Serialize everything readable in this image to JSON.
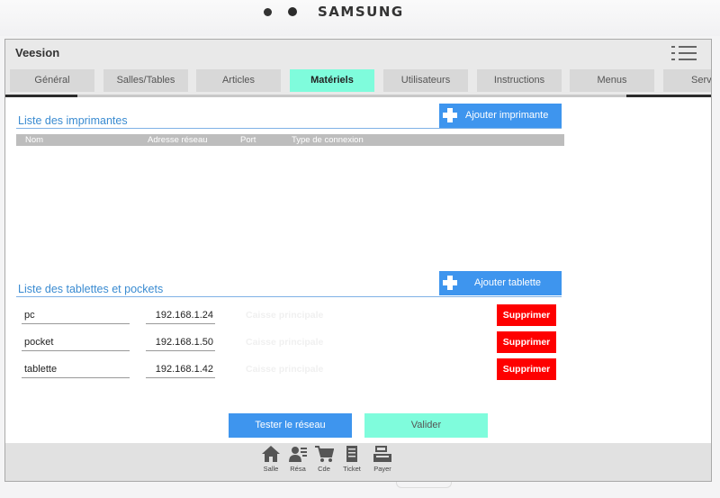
{
  "device": {
    "brand": "SAMSUNG"
  },
  "app": {
    "title": "Veesion"
  },
  "tabs": [
    {
      "label": "Général"
    },
    {
      "label": "Salles/Tables"
    },
    {
      "label": "Articles"
    },
    {
      "label": "Matériels"
    },
    {
      "label": "Utilisateurs"
    },
    {
      "label": "Instructions"
    },
    {
      "label": "Menus"
    },
    {
      "label": "Servi"
    }
  ],
  "printers": {
    "title": "Liste des imprimantes",
    "add_label": "Ajouter imprimante",
    "columns": [
      "Nom",
      "Adresse réseau",
      "Port",
      "Type de connexion"
    ],
    "rows": []
  },
  "tablets": {
    "title": "Liste des tablettes et pockets",
    "add_label": "Ajouter tablette",
    "rows": [
      {
        "name": "pc",
        "ip": "192.168.1.24",
        "register": "Caisse principale",
        "delete_label": "Supprimer"
      },
      {
        "name": "pocket",
        "ip": "192.168.1.50",
        "register": "Caisse principale",
        "delete_label": "Supprimer"
      },
      {
        "name": "tablette",
        "ip": "192.168.1.42",
        "register": "Caisse principale",
        "delete_label": "Supprimer"
      }
    ]
  },
  "actions": {
    "test_label": "Tester le réseau",
    "validate_label": "Valider"
  },
  "bottom_nav": [
    {
      "label": "Salle",
      "icon": "home-icon"
    },
    {
      "label": "Résa",
      "icon": "reservation-icon"
    },
    {
      "label": "Cde",
      "icon": "cart-icon"
    },
    {
      "label": "Ticket",
      "icon": "ticket-icon"
    },
    {
      "label": "Payer",
      "icon": "register-icon"
    }
  ],
  "colors": {
    "accent_blue": "#3e95ee",
    "active_tab": "#7ffcdc",
    "delete_red": "#fe0000",
    "section_title": "#3a8bd1"
  }
}
